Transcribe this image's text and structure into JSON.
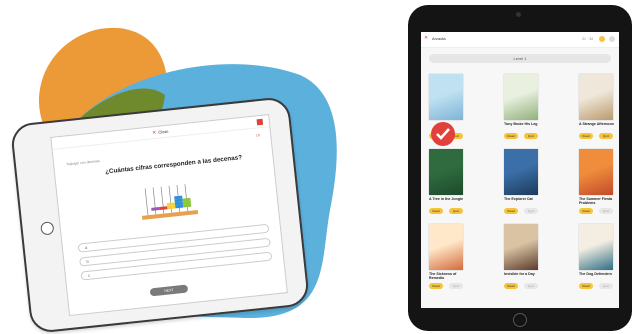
{
  "colors": {
    "orange": "#ec9a37",
    "olive": "#6e8a2c",
    "sky": "#5bb0dc",
    "accent": "#e2403a",
    "yellow": "#f5c43a"
  },
  "left_tablet": {
    "header_title": "Close",
    "close_icon": "close-icon",
    "menu_icon": "menu-icon",
    "progress": "1/5",
    "subtitle": "Trabajar con decenas",
    "question": "¿Cuántas cifras corresponden a las decenas?",
    "answers": [
      "a",
      "b",
      "c"
    ],
    "next_label": "NEXT"
  },
  "right_tablet": {
    "header_title": "Arcadia",
    "stats": "21 · 34",
    "level_label": "Level 1",
    "books": [
      {
        "title": "",
        "read": "Read",
        "quiz": "Quiz",
        "colors": [
          "#bfe1f1",
          "#7fb3d6"
        ]
      },
      {
        "title": "Tony Broke His Leg",
        "read": "Read",
        "quiz": "Quiz",
        "colors": [
          "#e9f0e0",
          "#8fb07a"
        ]
      },
      {
        "title": "A Strange Afternoon",
        "read": "Read",
        "quiz": "Quiz",
        "colors": [
          "#efe8da",
          "#b99a6e"
        ]
      },
      {
        "title": "A Tree in the Jungle",
        "read": "Read",
        "quiz": "Quiz",
        "colors": [
          "#2f6b3f",
          "#1e4a2b"
        ]
      },
      {
        "title": "The Explorer Cat",
        "read": "Read",
        "quiz": "Quiz",
        "colors": [
          "#3b6fa8",
          "#1b3a5a"
        ]
      },
      {
        "title": "The Summer Fiesta Problems",
        "read": "Read",
        "quiz": "Quiz",
        "colors": [
          "#f08d3d",
          "#c24a2a"
        ]
      },
      {
        "title": "The Sickness of Remedio",
        "read": "Read",
        "quiz": "Quiz",
        "colors": [
          "#ffe8c9",
          "#d46b3d"
        ]
      },
      {
        "title": "Invisible for a Day",
        "read": "Read",
        "quiz": "Quiz",
        "colors": [
          "#d9c3a3",
          "#5b3a2b"
        ]
      },
      {
        "title": "The Dog Defenders",
        "read": "Read",
        "quiz": "Quiz",
        "colors": [
          "#f4eee2",
          "#2d6e86"
        ]
      }
    ]
  }
}
